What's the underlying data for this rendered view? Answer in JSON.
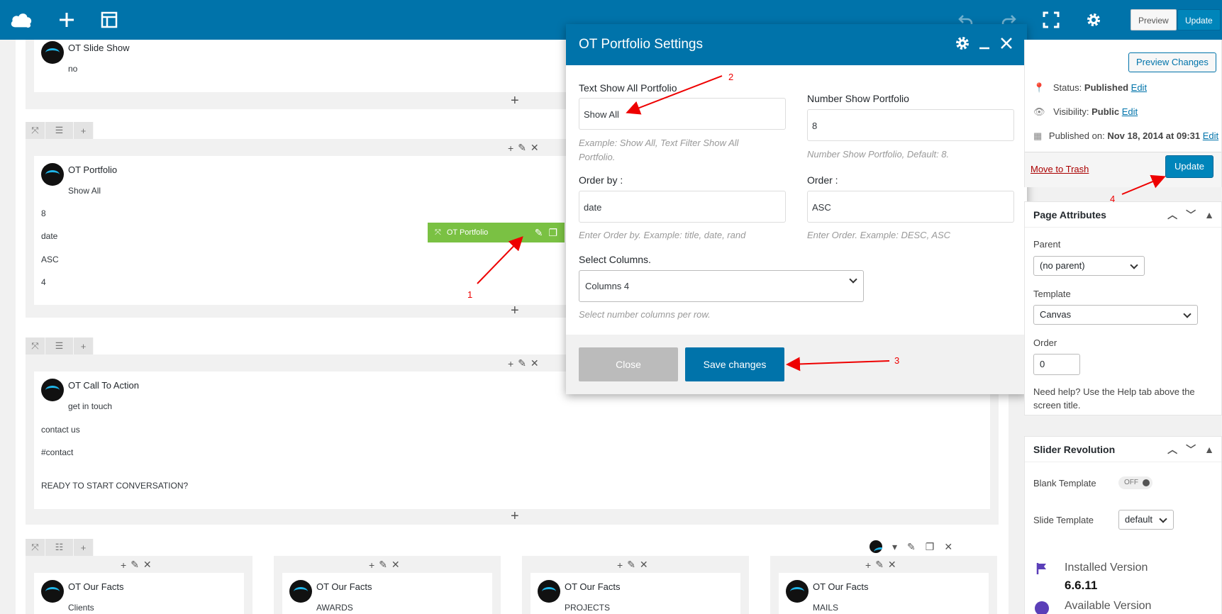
{
  "topbar": {
    "preview_label": "Preview",
    "update_label": "Update"
  },
  "rows": {
    "slideshow": {
      "title": "OT Slide Show",
      "value": "no"
    },
    "portfolio": {
      "title": "OT Portfolio",
      "text": "Show All",
      "number": "8",
      "orderby": "date",
      "order": "ASC",
      "columns": "4"
    },
    "portfolio_toolbar_label": "OT Portfolio",
    "cta": {
      "title": "OT Call To Action",
      "text": "get in touch",
      "button": "contact us",
      "link": "#contact",
      "heading": "READY TO START CONVERSATION?"
    },
    "facts": [
      {
        "title": "OT Our Facts",
        "label": "Clients"
      },
      {
        "title": "OT Our Facts",
        "label": "AWARDS"
      },
      {
        "title": "OT Our Facts",
        "label": "PROJECTS"
      },
      {
        "title": "OT Our Facts",
        "label": "MAILS"
      }
    ]
  },
  "modal": {
    "title": "OT Portfolio Settings",
    "text_show_all": {
      "label": "Text Show All Portfolio",
      "value": "Show All",
      "help": "Example: Show All, Text Filter Show All Portfolio."
    },
    "number_show": {
      "label": "Number Show Portfolio",
      "value": "8",
      "help": "Number Show Portfolio, Default: 8."
    },
    "order_by": {
      "label": "Order by :",
      "value": "date",
      "help": "Enter Order by. Example: title, date, rand"
    },
    "order": {
      "label": "Order :",
      "value": "ASC",
      "help": "Enter Order. Example: DESC, ASC"
    },
    "columns": {
      "label": "Select Columns.",
      "value": "Columns 4",
      "help": "Select number columns per row."
    },
    "close_label": "Close",
    "save_label": "Save changes"
  },
  "publish": {
    "preview_changes": "Preview Changes",
    "status_label": "Status:",
    "status_value": "Published",
    "visibility_label": "Visibility:",
    "visibility_value": "Public",
    "published_label": "Published on:",
    "published_value": "Nov 18, 2014 at 09:31",
    "edit": "Edit",
    "trash": "Move to Trash",
    "update": "Update"
  },
  "page_attributes": {
    "title": "Page Attributes",
    "parent_label": "Parent",
    "parent_value": "(no parent)",
    "template_label": "Template",
    "template_value": "Canvas",
    "order_label": "Order",
    "order_value": "0",
    "help": "Need help? Use the Help tab above the screen title."
  },
  "slider_revolution": {
    "title": "Slider Revolution",
    "blank_template_label": "Blank Template",
    "toggle_label": "OFF",
    "slide_template_label": "Slide Template",
    "slide_template_value": "default",
    "installed_label": "Installed Version",
    "installed_value": "6.6.11",
    "available_label": "Available Version"
  },
  "annotations": [
    "1",
    "2",
    "3",
    "4"
  ]
}
